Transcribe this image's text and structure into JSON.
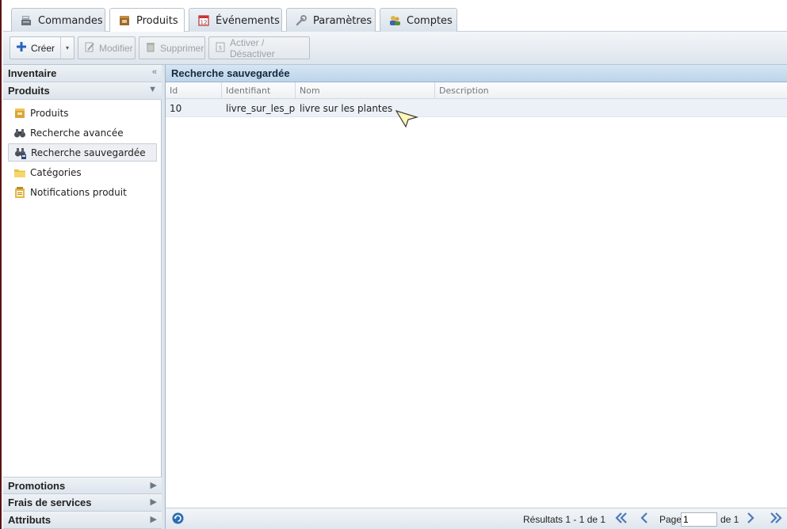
{
  "tabs": [
    {
      "label": "Commandes",
      "icon": "register-icon",
      "active": false
    },
    {
      "label": "Produits",
      "icon": "box-icon",
      "active": true
    },
    {
      "label": "Événements",
      "icon": "calendar-icon",
      "active": false
    },
    {
      "label": "Paramètres",
      "icon": "wrench-icon",
      "active": false
    },
    {
      "label": "Comptes",
      "icon": "users-icon",
      "active": false
    }
  ],
  "toolbar": {
    "create_label": "Créer",
    "edit_label": "Modifier",
    "delete_label": "Supprimer",
    "toggle_label": "Activer / Désactiver"
  },
  "sidebar": {
    "inventory_header": "Inventaire",
    "inventory_collapse": "«",
    "products_header": "Produits",
    "products_arrow": "▼",
    "items": [
      {
        "label": "Produits",
        "icon": "box-icon"
      },
      {
        "label": "Recherche avancée",
        "icon": "binoculars-icon"
      },
      {
        "label": "Recherche sauvegardée",
        "icon": "saved-search-icon",
        "selected": true
      },
      {
        "label": "Catégories",
        "icon": "folder-icon"
      },
      {
        "label": "Notifications produit",
        "icon": "notification-icon"
      }
    ],
    "bottom_sections": [
      {
        "label": "Promotions",
        "arrow": "▶"
      },
      {
        "label": "Frais de services",
        "arrow": "▶"
      },
      {
        "label": "Attributs",
        "arrow": "▶"
      }
    ]
  },
  "main": {
    "title": "Recherche sauvegardée",
    "columns": [
      "Id",
      "Identifiant",
      "Nom",
      "Description"
    ],
    "rows": [
      {
        "id": "10",
        "identifier": "livre_sur_les_p",
        "name": "livre sur les plantes",
        "description": ""
      }
    ]
  },
  "paging": {
    "results_text": "Résultats 1 - 1 de 1",
    "page_label": "Page",
    "page_value": "1",
    "of_text": "de 1"
  },
  "colors": {
    "accent": "#bcd4ea",
    "border_accent": "#5a1414"
  }
}
